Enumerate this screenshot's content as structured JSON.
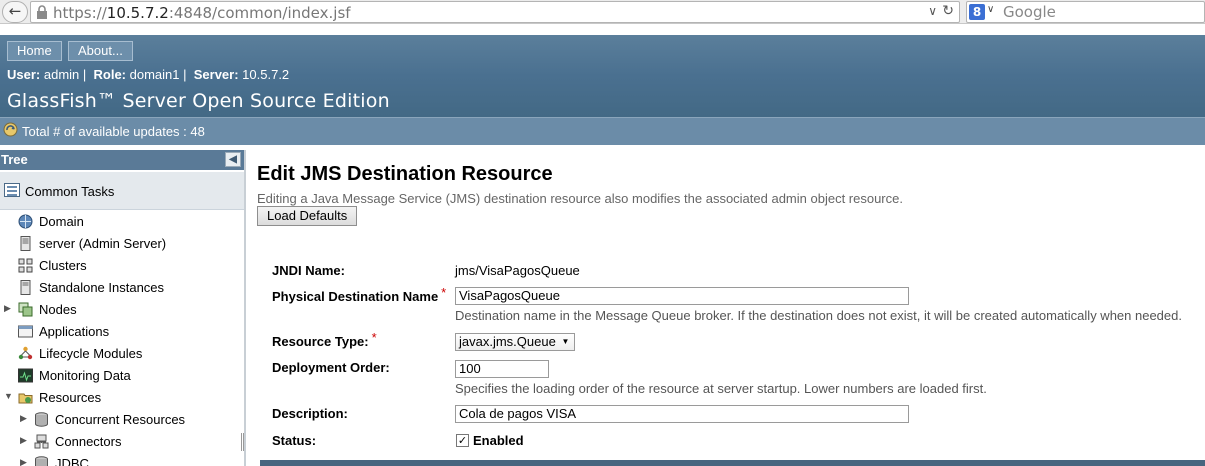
{
  "browser": {
    "url_prefix": "https://",
    "url_host": "10.5.7.2",
    "url_rest": ":4848/common/index.jsf",
    "search_placeholder": "Google"
  },
  "header": {
    "buttons": {
      "home": "Home",
      "about": "About..."
    },
    "user_label": "User:",
    "user": "admin",
    "role_label": "Role:",
    "role": "domain1",
    "server_label": "Server:",
    "server": "10.5.7.2",
    "product": "GlassFish™ Server Open Source Edition",
    "updates": "Total # of available updates : 48"
  },
  "tree": {
    "title": "Tree",
    "common_tasks": "Common Tasks",
    "items": [
      {
        "label": "Domain",
        "icon": "domain-icon",
        "expandable": false
      },
      {
        "label": "server (Admin Server)",
        "icon": "server-icon",
        "expandable": false
      },
      {
        "label": "Clusters",
        "icon": "clusters-icon",
        "expandable": false
      },
      {
        "label": "Standalone Instances",
        "icon": "instances-icon",
        "expandable": false
      },
      {
        "label": "Nodes",
        "icon": "nodes-icon",
        "expandable": true
      },
      {
        "label": "Applications",
        "icon": "applications-icon",
        "expandable": false
      },
      {
        "label": "Lifecycle Modules",
        "icon": "lifecycle-icon",
        "expandable": false
      },
      {
        "label": "Monitoring Data",
        "icon": "monitoring-icon",
        "expandable": false
      },
      {
        "label": "Resources",
        "icon": "resources-icon",
        "expandable": true,
        "expanded": true
      },
      {
        "label": "Concurrent Resources",
        "icon": "concurrent-icon",
        "expandable": true
      },
      {
        "label": "Connectors",
        "icon": "connectors-icon",
        "expandable": true
      },
      {
        "label": "JDBC",
        "icon": "jdbc-icon",
        "expandable": true
      }
    ]
  },
  "main": {
    "title": "Edit JMS Destination Resource",
    "help": "Editing a Java Message Service (JMS) destination resource also modifies the associated admin object resource.",
    "load_defaults": "Load Defaults",
    "required_mark": "*",
    "fields": {
      "jndi_label": "JNDI Name:",
      "jndi_value": "jms/VisaPagosQueue",
      "physical_label": "Physical Destination Name",
      "physical_value": "VisaPagosQueue",
      "physical_help": "Destination name in the Message Queue broker. If the destination does not exist, it will be created automatically when needed.",
      "type_label": "Resource Type:",
      "type_value": "javax.jms.Queue",
      "order_label": "Deployment Order:",
      "order_value": "100",
      "order_help": "Specifies the loading order of the resource at server startup. Lower numbers are loaded first.",
      "desc_label": "Description:",
      "desc_value": "Cola de pagos VISA",
      "status_label": "Status:",
      "status_check": "✓",
      "status_value": "Enabled"
    }
  },
  "colors": {
    "header_blue": "#4a7090",
    "tree_head": "#5a7a97",
    "required_red": "#cc0000"
  }
}
